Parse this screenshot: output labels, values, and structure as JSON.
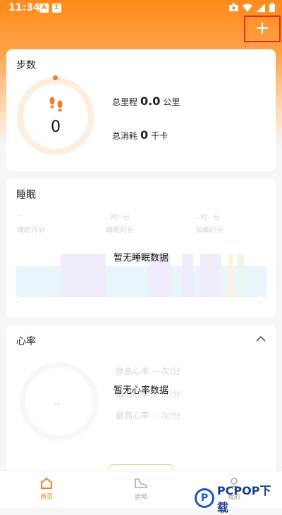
{
  "status_bar": {
    "time": "11:34",
    "app_icon_1": "A",
    "app_icon_2": "Σ"
  },
  "header": {
    "add_label": "+"
  },
  "steps_card": {
    "title": "步数",
    "steps": "0",
    "distance_label": "总里程",
    "distance_value": "0.0",
    "distance_unit": "公里",
    "calorie_label": "总消耗",
    "calorie_value": "0",
    "calorie_unit": "千卡"
  },
  "sleep_card": {
    "title": "睡眠",
    "stats": [
      {
        "value": "--",
        "label": "睡眠得分"
      },
      {
        "value": "--时--分",
        "label": "睡眠时长"
      },
      {
        "value": "--时--分",
        "label": "深睡时长"
      }
    ],
    "empty_text": "暂无睡眠数据",
    "axis_left": "--",
    "axis_right": "--",
    "colors": {
      "light": "#e8f6fc",
      "awake": "#f1ecfb",
      "rem": "#fbf3d9"
    }
  },
  "heart_card": {
    "title": "心率",
    "ring_value": "--",
    "rows": [
      {
        "label": "静息心率",
        "value": "--",
        "unit": "次/分"
      },
      {
        "label": "最低心率",
        "value": "--",
        "unit": "次/分"
      },
      {
        "label": "最高心率",
        "value": "--",
        "unit": "次/分"
      }
    ],
    "empty_text": "暂无心率数据"
  },
  "bottom_nav": [
    {
      "label": "首页",
      "icon": "home-icon"
    },
    {
      "label": "运动",
      "icon": "shoe-icon"
    },
    {
      "label": "我的",
      "icon": "person-icon"
    }
  ],
  "watermark": {
    "logo": "P",
    "text": "PCPOP下载"
  },
  "colors": {
    "accent": "#f07d23",
    "highlight_box": "#e0311b"
  }
}
